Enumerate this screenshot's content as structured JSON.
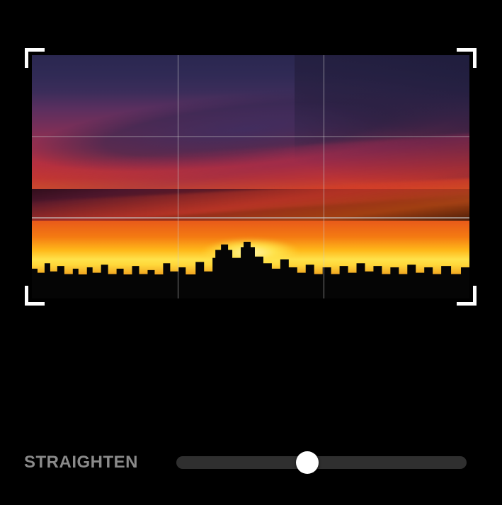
{
  "controls": {
    "straighten": {
      "label": "STRAIGHTEN",
      "value": 0,
      "min": -45,
      "max": 45,
      "thumb_position_pct": 45
    }
  },
  "crop": {
    "grid": "rule-of-thirds",
    "corners": [
      "tl",
      "tr",
      "bl",
      "br"
    ]
  },
  "image": {
    "description": "sunset-skyline"
  }
}
